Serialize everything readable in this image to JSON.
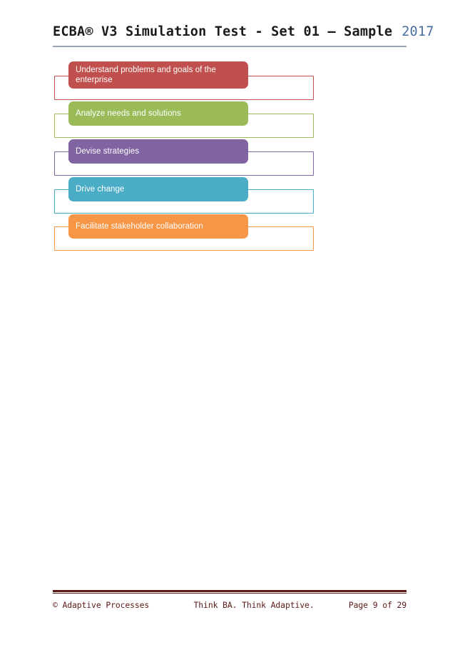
{
  "header": {
    "title": "ECBA® V3 Simulation Test  -  Set 01 – Sample",
    "year": "2017",
    "divider_color": "#a6a6a6",
    "rule_color": "#9aa4b0",
    "year_color": "#4a6fa0"
  },
  "diagram": {
    "name": "business-analysis-core-concepts-list",
    "items": [
      {
        "label": "Understand problems and goals of the enterprise",
        "color": "#c0504d",
        "two_line": true
      },
      {
        "label": "Analyze needs and solutions",
        "color": "#9bbb59",
        "two_line": false
      },
      {
        "label": "Devise strategies",
        "color": "#8064a2",
        "two_line": false
      },
      {
        "label": "Drive change",
        "color": "#4bacc6",
        "two_line": false
      },
      {
        "label": "Facilitate stakeholder collaboration",
        "color": "#f79646",
        "two_line": false
      }
    ]
  },
  "footer": {
    "copyright": "© Adaptive Processes",
    "tagline": "Think BA. Think Adaptive.",
    "page": "Page 9 of 29",
    "rule_color": "#5b1a18"
  }
}
